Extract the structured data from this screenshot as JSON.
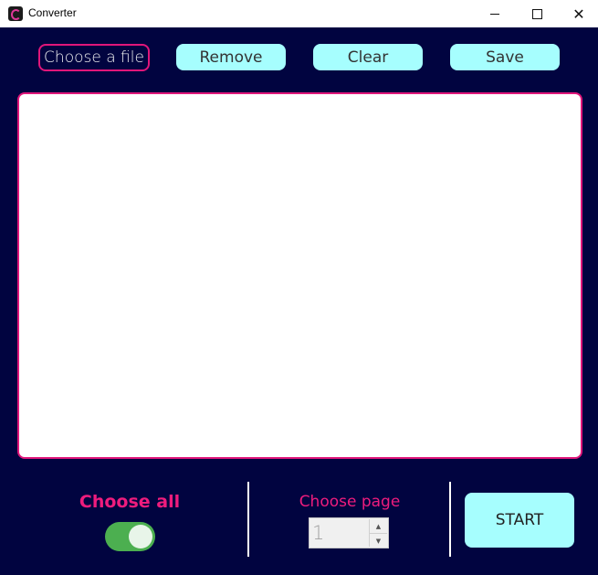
{
  "window": {
    "title": "Converter",
    "controls": {
      "minimize": "–",
      "maximize": "□",
      "close": "✕"
    }
  },
  "toolbar": {
    "choose_file_label": "Choose a file",
    "remove_label": "Remove",
    "clear_label": "Clear",
    "save_label": "Save"
  },
  "editor": {
    "value": ""
  },
  "bottom": {
    "choose_all_label": "Choose all",
    "choose_all_on": true,
    "choose_page_label": "Choose page",
    "page_value": "1",
    "start_label": "START"
  },
  "colors": {
    "background": "#010440",
    "accent_pink": "#e0167a",
    "button_cyan": "#a6fefe",
    "toggle_green": "#4caf50"
  }
}
